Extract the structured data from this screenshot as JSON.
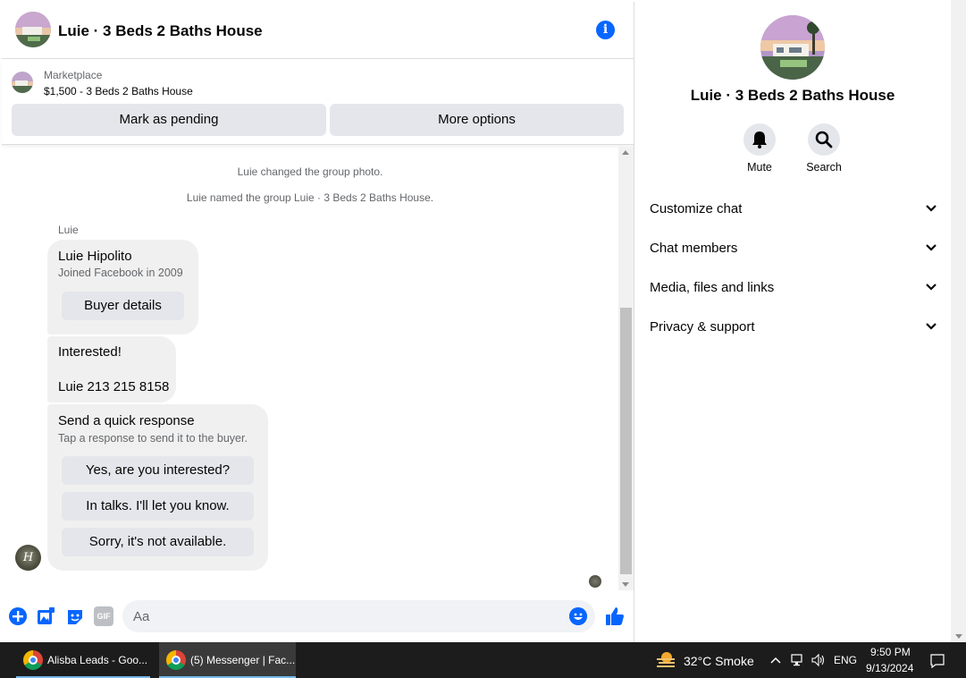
{
  "chat": {
    "title": "Luie · 3 Beds 2 Baths House"
  },
  "marketplace": {
    "label": "Marketplace",
    "listing": "$1,500 - 3 Beds 2 Baths House",
    "mark_pending": "Mark as pending",
    "more_options": "More options"
  },
  "messages": {
    "system": [
      "Luie changed the group photo.",
      "Luie named the group Luie · 3 Beds 2 Baths House."
    ],
    "sender": "Luie",
    "profile_card": {
      "name": "Luie Hipolito",
      "joined": "Joined Facebook in 2009",
      "button": "Buyer details"
    },
    "text_line1": "Interested!",
    "text_line2": "Luie 213 215 8158",
    "quick_response": {
      "title": "Send a quick response",
      "subtitle": "Tap a response to send it to the buyer.",
      "options": [
        "Yes, are you interested?",
        "In talks. I'll let you know.",
        "Sorry, it's not available."
      ]
    },
    "sender_avatar_letter": "H"
  },
  "composer": {
    "placeholder": "Aa",
    "gif_label": "GIF"
  },
  "info_pane": {
    "title": "Luie · 3 Beds 2 Baths House",
    "mute_label": "Mute",
    "search_label": "Search",
    "sections": [
      "Customize chat",
      "Chat members",
      "Media, files and links",
      "Privacy & support"
    ]
  },
  "taskbar": {
    "apps": [
      "Alisba Leads - Goo...",
      "(5) Messenger | Fac..."
    ],
    "weather": "32°C  Smoke",
    "language": "ENG",
    "time": "9:50 PM",
    "date": "9/13/2024"
  },
  "colors": {
    "accent": "#0866ff",
    "bubble": "#f0f0f0",
    "button": "#e4e6eb",
    "taskbar": "#1c1c1c"
  }
}
